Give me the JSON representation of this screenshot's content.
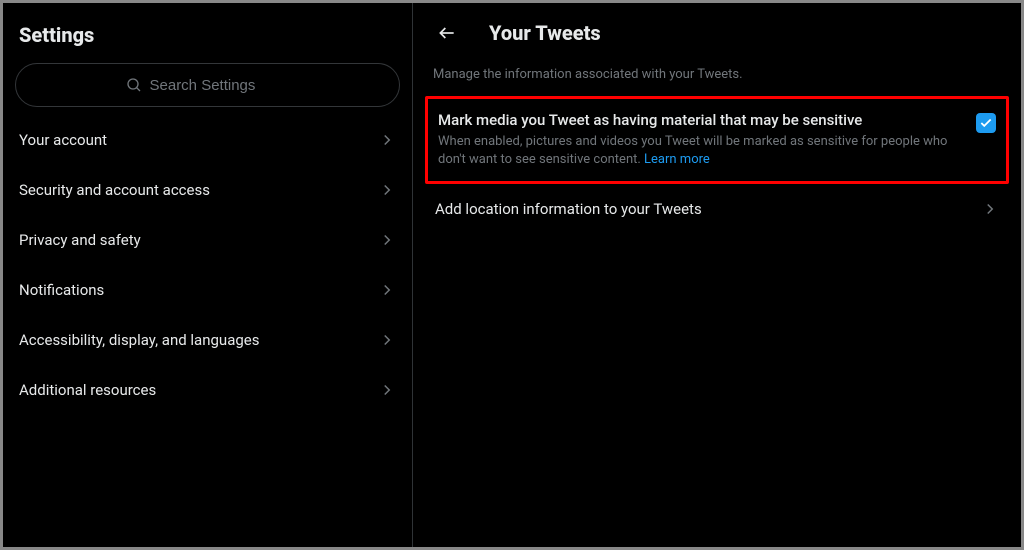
{
  "sidebar": {
    "title": "Settings",
    "search": {
      "placeholder": "Search Settings"
    },
    "items": [
      {
        "label": "Your account"
      },
      {
        "label": "Security and account access"
      },
      {
        "label": "Privacy and safety"
      },
      {
        "label": "Notifications"
      },
      {
        "label": "Accessibility, display, and languages"
      },
      {
        "label": "Additional resources"
      }
    ]
  },
  "main": {
    "title": "Your Tweets",
    "subtitle": "Manage the information associated with your Tweets.",
    "sensitive": {
      "title": "Mark media you Tweet as having material that may be sensitive",
      "desc": "When enabled, pictures and videos you Tweet will be marked as sensitive for people who don't want to see sensitive content. ",
      "learn_more": "Learn more",
      "checked": true
    },
    "location": {
      "title": "Add location information to your Tweets"
    }
  }
}
